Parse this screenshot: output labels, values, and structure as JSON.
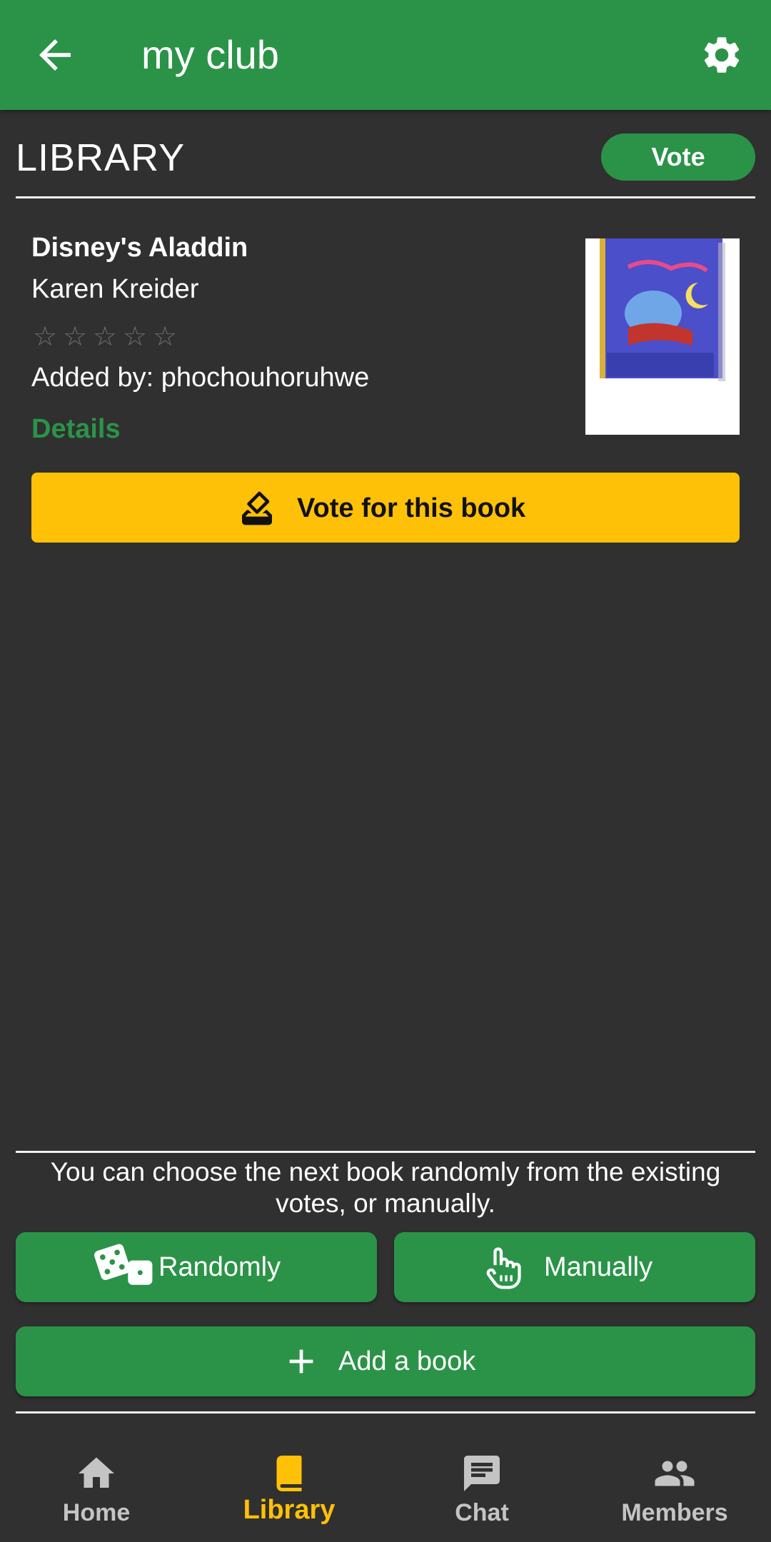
{
  "appbar": {
    "title": "my club",
    "back_icon": "arrow-back-icon",
    "settings_icon": "gear-icon"
  },
  "colors": {
    "primary": "#2b9348",
    "accent": "#ffc107",
    "background": "#303030"
  },
  "library": {
    "heading": "LIBRARY",
    "vote_label": "Vote"
  },
  "book": {
    "title": "Disney's Aladdin",
    "author": "Karen Kreider",
    "rating": 0,
    "rating_max": 5,
    "stars": [
      "☆",
      "☆",
      "☆",
      "☆",
      "☆"
    ],
    "added_by": "Added by: phochouhoruhwe",
    "details_label": "Details",
    "vote_button_label": "Vote for this book"
  },
  "choose": {
    "text": "You can choose the next book randomly from the existing votes, or manually.",
    "randomly_label": "Randomly",
    "manually_label": "Manually"
  },
  "add_book_label": "Add a book",
  "nav": {
    "home": "Home",
    "library": "Library",
    "chat": "Chat",
    "members": "Members",
    "active": "library"
  }
}
